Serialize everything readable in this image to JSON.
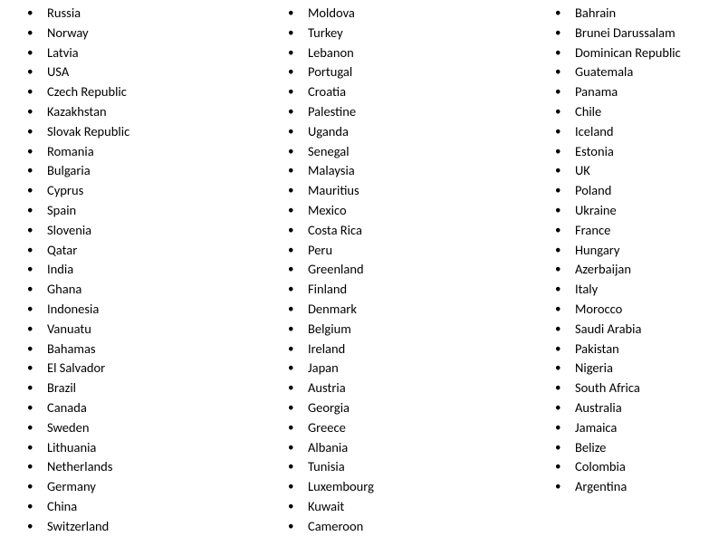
{
  "columns": [
    {
      "items": [
        "Russia",
        "Norway",
        "Latvia",
        "USA",
        "Czech Republic",
        "Kazakhstan",
        "Slovak Republic",
        "Romania",
        "Bulgaria",
        "Cyprus",
        "Spain",
        "Slovenia",
        "Qatar",
        "India",
        "Ghana",
        "Indonesia",
        "Vanuatu",
        "Bahamas",
        "El Salvador",
        "Brazil",
        "Canada",
        "Sweden",
        "Lithuania",
        "Netherlands",
        "Germany",
        "China",
        "Switzerland"
      ]
    },
    {
      "items": [
        "Moldova",
        "Turkey",
        "Lebanon",
        "Portugal",
        "Croatia",
        "Palestine",
        "Uganda",
        "Senegal",
        "Malaysia",
        "Mauritius",
        "Mexico",
        "Costa Rica",
        "Peru",
        "Greenland",
        "Finland",
        "Denmark",
        "Belgium",
        "Ireland",
        "Japan",
        "Austria",
        "Georgia",
        "Greece",
        "Albania",
        "Tunisia",
        "Luxembourg",
        "Kuwait",
        "Cameroon"
      ]
    },
    {
      "items": [
        "Bahrain",
        "Brunei Darussalam",
        "Dominican Republic",
        "Guatemala",
        "Panama",
        "Chile",
        "Iceland",
        "Estonia",
        "UK",
        "Poland",
        "Ukraine",
        "France",
        "Hungary",
        "Azerbaijan",
        "Italy",
        "Morocco",
        "Saudi Arabia",
        "Pakistan",
        "Nigeria",
        "South Africa",
        "Australia",
        "Jamaica",
        "Belize",
        "Colombia",
        "Argentina"
      ]
    }
  ]
}
